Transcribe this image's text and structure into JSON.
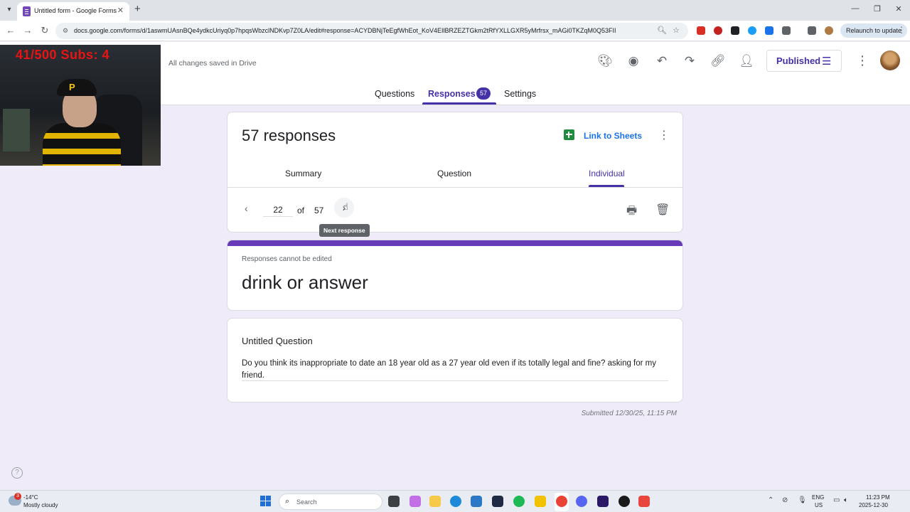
{
  "browser": {
    "tab_title": "Untitled form - Google Forms",
    "url": "docs.google.com/forms/d/1aswmUAsnBQe4ydkcUriyq0p7hpqsWbzclNDKvp7Z0LA/edit#response=ACYDBNjTeEgfWhEot_KoV4EIlBRZEZTGkm2tRfYXLLGXR5yMrfrsx_mAGi0TKZqM0Q53FII",
    "relaunch_label": "Relaunch to update"
  },
  "forms": {
    "saved_status": "All changes saved in Drive",
    "published_label": "Published",
    "tabs": [
      {
        "label": "Questions"
      },
      {
        "label": "Responses",
        "badge": "57"
      },
      {
        "label": "Settings"
      }
    ]
  },
  "webcam": {
    "overlay_text": "41/500  Subs: 4"
  },
  "responses": {
    "title": "57 responses",
    "link_to_sheets": "Link to Sheets",
    "subtabs": [
      {
        "label": "Summary"
      },
      {
        "label": "Question"
      },
      {
        "label": "Individual"
      }
    ],
    "current": "22",
    "of_label": "of",
    "total": "57",
    "tooltip": "Next response"
  },
  "form": {
    "cannot_edit": "Responses cannot be edited",
    "title": "drink or answer",
    "question_title": "Untitled Question",
    "answer": "Do you think its inappropriate to date an 18 year old as a 27 year old even if its totally legal and fine? asking for my friend.",
    "submitted": "Submitted 12/30/25, 11:15 PM"
  },
  "taskbar": {
    "weather_badge": "3",
    "weather_temp": "-14°C",
    "weather_condition": "Mostly cloudy",
    "search_label": "Search",
    "lang_1": "ENG",
    "lang_2": "US",
    "time": "11:23 PM",
    "date": "2025-12-30"
  },
  "colors": {
    "accent": "#4531a8",
    "form_theme": "#673ab7",
    "background": "#f0ebf8"
  }
}
